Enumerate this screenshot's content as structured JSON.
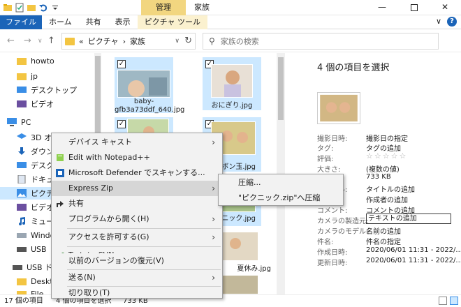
{
  "window": {
    "context_tab_group": "管理",
    "title": "家族",
    "minimize_glyph": "—",
    "close_glyph": "✕"
  },
  "ribbon": {
    "tabs": [
      "ファイル",
      "ホーム",
      "共有",
      "表示",
      "ピクチャ ツール"
    ],
    "expand_glyph": "∨",
    "help_glyph": "?"
  },
  "nav": {
    "back_glyph": "←",
    "forward_glyph": "→",
    "dropdown_glyph": "∨",
    "up_glyph": "↑",
    "breadcrumb": [
      "«",
      "ピクチャ",
      "›",
      "家族"
    ],
    "search_placeholder": "家族の検索"
  },
  "navpane": {
    "items": [
      {
        "label": "howto",
        "icon": "folder-icon"
      },
      {
        "label": "jp",
        "icon": "folder-icon"
      },
      {
        "label": "デスクトップ",
        "icon": "desktop-icon"
      },
      {
        "label": "ビデオ",
        "icon": "video-icon"
      },
      {
        "label": "PC",
        "icon": "pc-icon"
      },
      {
        "label": "3D オブジェクト",
        "icon": "3d-icon"
      },
      {
        "label": "ダウンロード",
        "icon": "download-icon"
      },
      {
        "label": "デスクトップ",
        "icon": "desktop-icon"
      },
      {
        "label": "ドキュメント",
        "icon": "document-icon"
      },
      {
        "label": "ピクチャ",
        "icon": "picture-icon"
      },
      {
        "label": "ビデオ",
        "icon": "video-icon"
      },
      {
        "label": "ミュージック",
        "icon": "music-icon"
      },
      {
        "label": "Windows (C:)",
        "icon": "drive-icon"
      },
      {
        "label": "USB ドライブ",
        "icon": "usb-icon"
      },
      {
        "label": "USB ドライブ",
        "icon": "usb-icon"
      },
      {
        "label": "Desktop",
        "icon": "folder-icon"
      },
      {
        "label": "File",
        "icon": "folder-icon"
      }
    ]
  },
  "files": [
    {
      "name": "baby-gfb3a73ddf_640.jpg",
      "checked": "✓"
    },
    {
      "name": "おにぎり.jpg",
      "checked": "✓"
    },
    {
      "name": "",
      "checked": "✓"
    },
    {
      "name": "シャボン玉.jpg",
      "checked": "✓"
    },
    {
      "name": "ピクニック.jpg",
      "checked": ""
    },
    {
      "name": "夏休み.jpg",
      "checked": ""
    }
  ],
  "details": {
    "title": "4 個の項目を選択",
    "properties": [
      {
        "key": "撮影日時:",
        "value": "撮影日の指定"
      },
      {
        "key": "タグ:",
        "value": "タグの追加"
      },
      {
        "key": "評価:",
        "value": "☆☆☆☆☆"
      },
      {
        "key": "大きさ:",
        "value": "(複数の値)"
      },
      {
        "key": "サイズ:",
        "value": "733 KB"
      },
      {
        "key": "タイトル:",
        "value": "タイトルの追加"
      },
      {
        "key": "作成者:",
        "value": "作成者の追加"
      },
      {
        "key": "コメント:",
        "value": "コメントの追加"
      },
      {
        "key": "カメラの製造元:",
        "value": "テキストの追加"
      },
      {
        "key": "カメラのモデル:",
        "value": "名前の追加"
      },
      {
        "key": "件名:",
        "value": "件名の指定"
      },
      {
        "key": "作成日時:",
        "value": "2020/06/01 11:31 - 2022/..."
      },
      {
        "key": "更新日時:",
        "value": "2020/06/01 11:31 - 2022/..."
      }
    ]
  },
  "status": {
    "count": "17 個の項目",
    "selection": "4 個の項目を選択",
    "size": "733 KB"
  },
  "context_menu": {
    "items": [
      {
        "label": "デバイス キャスト",
        "arrow": "›",
        "icon": ""
      },
      {
        "label": "Edit with Notepad++",
        "arrow": "",
        "icon": "notepad-icon"
      },
      {
        "label": "Microsoft Defender でスキャンする...",
        "arrow": "",
        "icon": "defender-icon"
      },
      {
        "label": "Express Zip",
        "arrow": "›",
        "icon": ""
      },
      {
        "label": "共有",
        "arrow": "",
        "icon": "share-icon"
      },
      {
        "label": "プログラムから開く(H)",
        "arrow": "›",
        "icon": ""
      },
      {
        "label": "アクセスを許可する(G)",
        "arrow": "›",
        "icon": ""
      },
      {
        "label": "TortoiseSVN",
        "arrow": "›",
        "icon": "tortoise-icon"
      },
      {
        "label": "以前のバージョンの復元(V)",
        "arrow": "",
        "icon": ""
      },
      {
        "label": "送る(N)",
        "arrow": "›",
        "icon": ""
      },
      {
        "label": "切り取り(T)",
        "arrow": "",
        "icon": ""
      }
    ],
    "submenu": [
      {
        "label": "圧縮..."
      },
      {
        "label": "\"ピクニック.zip\"へ圧縮"
      }
    ]
  },
  "colors": {
    "accent": "#1b64b8",
    "selection": "#cce8ff",
    "context_tab": "#f2d680"
  }
}
